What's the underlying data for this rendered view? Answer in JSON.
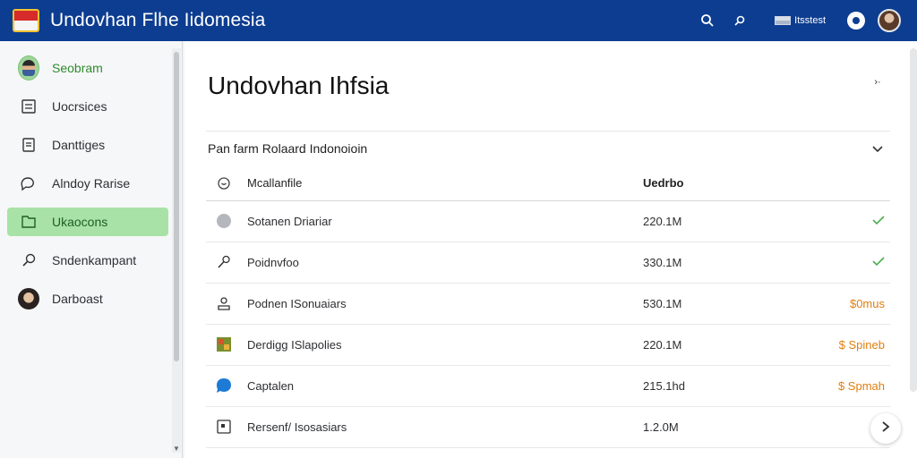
{
  "app": {
    "title": "Undovhan Flhe Iidomesia",
    "logo_icon": "flag-logo-icon",
    "accent_color": "#0d3d91"
  },
  "topbar": {
    "search_icon": "search-icon",
    "zoom_icon": "magnifier-icon",
    "language_label": "Itsstest",
    "help_icon": "help-icon",
    "user_avatar": "user-avatar"
  },
  "sidebar": {
    "items": [
      {
        "label": "Seobram",
        "icon": "avatar-icon",
        "active": false
      },
      {
        "label": "Uocrsices",
        "icon": "document-icon",
        "active": false
      },
      {
        "label": "Danttiges",
        "icon": "note-icon",
        "active": false
      },
      {
        "label": "Alndoy Rarise",
        "icon": "chat-icon",
        "active": false
      },
      {
        "label": "Ukaocons",
        "icon": "folder-icon",
        "active": true
      },
      {
        "label": "Sndenkampant",
        "icon": "search-icon",
        "active": false
      },
      {
        "label": "Darboast",
        "icon": "avatar-icon",
        "active": false
      }
    ],
    "active_color": "#a9e2a7"
  },
  "main": {
    "page_title": "Undovhan Ihfsia",
    "page_menu_label": "›·",
    "section_title": "Pan farm Rolaard Indonoioin",
    "table": {
      "headers": {
        "name": "Mcallanfile",
        "value": "Uedrbo",
        "status": ""
      },
      "rows": [
        {
          "icon": "circle-icon",
          "name": "Sotanen Driariar",
          "value": "220.1M",
          "status": "✓",
          "status_type": "check"
        },
        {
          "icon": "pen-icon",
          "name": "Poidnvfoo",
          "value": "330.1M",
          "status": "✓",
          "status_type": "check"
        },
        {
          "icon": "person-icon",
          "name": "Podnen ISonuaiars",
          "value": "530.1M",
          "status": "$0mus",
          "status_type": "money"
        },
        {
          "icon": "image-icon",
          "name": "Derdigg ISlapolies",
          "value": "220.1M",
          "status": "$ Spineb",
          "status_type": "money"
        },
        {
          "icon": "chat-bubble-icon",
          "name": "Captalen",
          "value": "215.1hd",
          "status": "$ Spmah",
          "status_type": "money"
        },
        {
          "icon": "box-icon",
          "name": "Rersenf/ Isosasiars",
          "value": "1.2.0M",
          "status": "",
          "status_type": "none"
        }
      ]
    },
    "check_color": "#4caf50",
    "money_color": "#e07f10"
  }
}
